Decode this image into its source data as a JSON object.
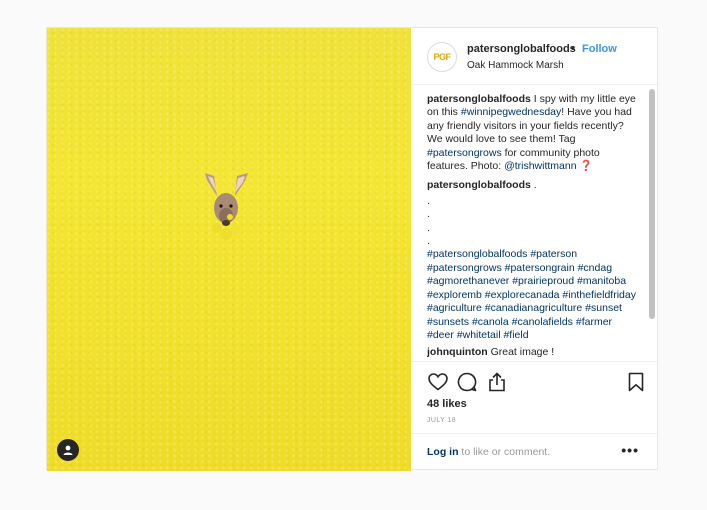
{
  "post": {
    "photo": {
      "alt_subject": "deer-in-canola-field"
    },
    "header": {
      "avatar_text": "PGF",
      "username": "patersonglobalfoods",
      "separator": "•",
      "follow_label": "Follow",
      "location": "Oak Hammock Marsh"
    },
    "caption": {
      "author": "patersonglobalfoods",
      "text_1": " I spy with my little eye on this ",
      "tag_1": "#winnipegwednesday",
      "text_2": "! Have you had any friendly visitors in your fields recently? We would love to see them! Tag ",
      "tag_2": "#patersongrows",
      "text_3": " for community photo features. Photo: ",
      "mention": "@trishwittmann",
      "text_4": " ❓"
    },
    "comment_1": {
      "author": "patersonglobalfoods",
      "text": " .",
      "dots": [
        ".",
        ".",
        ".",
        "."
      ],
      "hashtags": "#patersonglobalfoods #paterson #patersongrows #patersongrain #cndag #agmorethanever #prairieproud #manitoba #exploremb #explorecanada #inthefieldfriday #agriculture #canadianagriculture #sunset #sunsets #canola #canolafields #farmer #deer #whitetail #field"
    },
    "comment_2": {
      "author": "johnquinton",
      "text": " Great image !"
    },
    "likes": "48 likes",
    "date": "JULY 18",
    "login_link": "Log in",
    "login_text": " to like or comment.",
    "more_label": "•••"
  }
}
